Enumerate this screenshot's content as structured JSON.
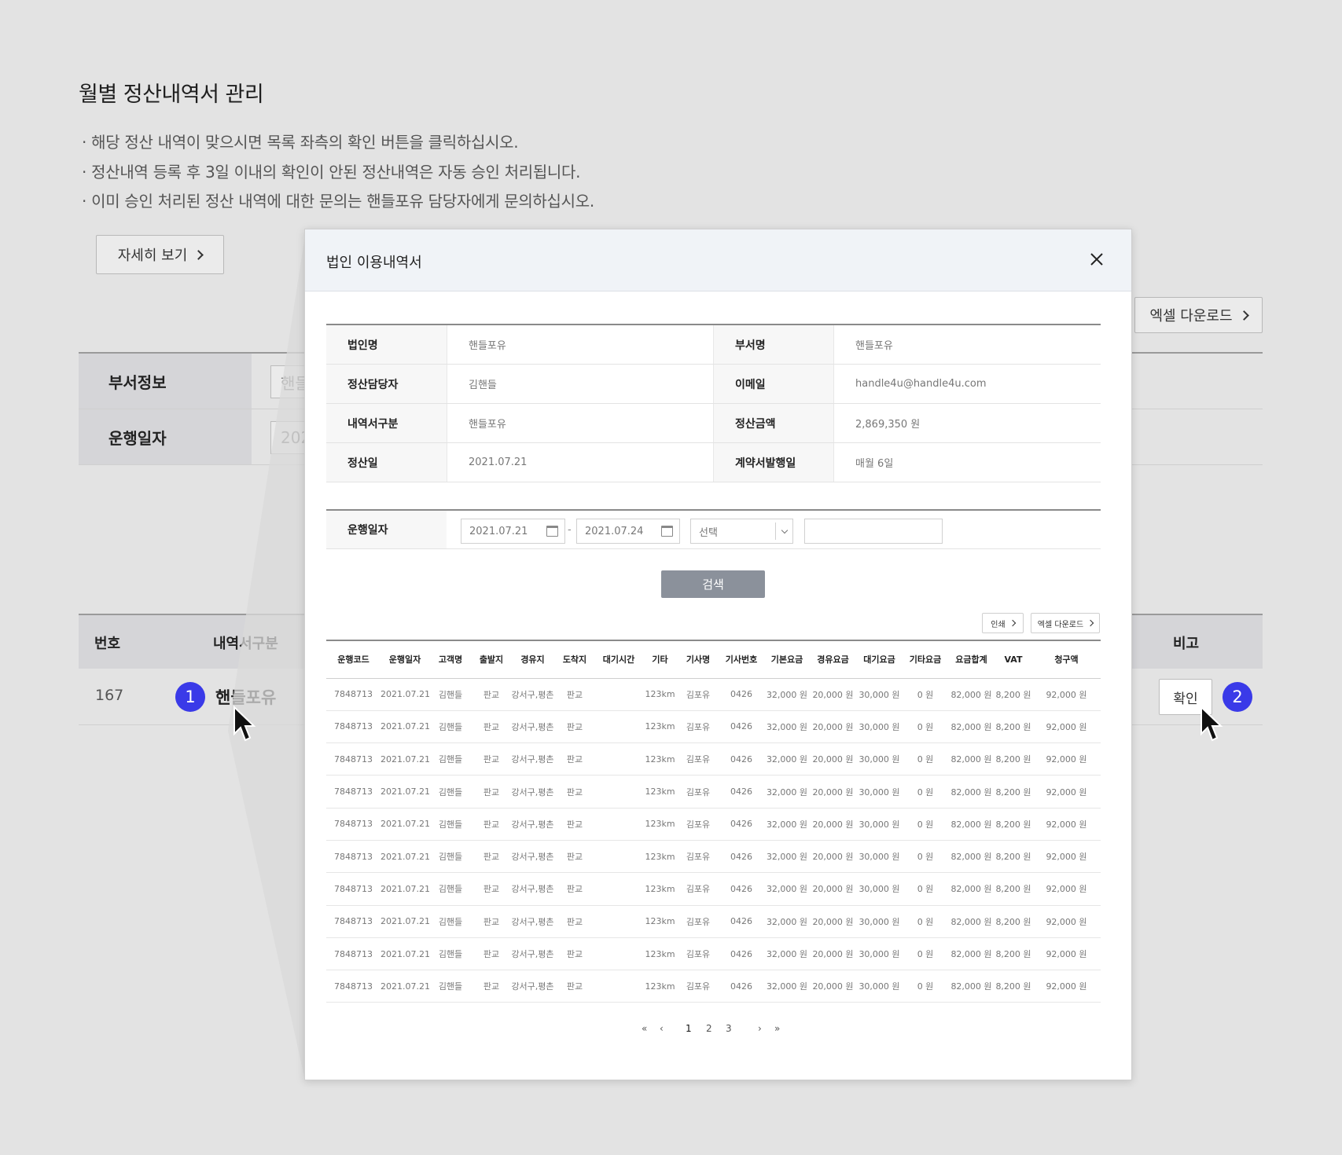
{
  "page": {
    "title": "월별 정산내역서 관리",
    "notices": [
      "· 해당 정산 내역이 맞으시면 목록 좌측의 확인 버튼을 클릭하십시오.",
      "· 정산내역 등록 후 3일 이내의 확인이 안된 정산내역은 자동 승인 처리됩니다.",
      "· 이미 승인 처리된 정산 내역에 대한 문의는 핸들포유 담당자에게 문의하십시오."
    ],
    "detail_button": "자세히 보기",
    "excel_button": "엑셀 다운로드",
    "filters": [
      {
        "label": "부서정보",
        "value": "핸들"
      },
      {
        "label": "운행일자",
        "value": "202"
      }
    ],
    "list_headers": {
      "num": "번호",
      "type": "내역서구분",
      "note": "비고"
    },
    "list_row": {
      "num": "167",
      "type": "핸들포유",
      "confirm": "확인"
    },
    "steps": [
      "1",
      "2"
    ]
  },
  "modal": {
    "title": "법인 이용내역서",
    "info": [
      [
        {
          "label": "법인명",
          "value": "핸들포유"
        },
        {
          "label": "부서명",
          "value": "핸들포유"
        }
      ],
      [
        {
          "label": "정산담당자",
          "value": "김핸들"
        },
        {
          "label": "이메일",
          "value": "handle4u@handle4u.com"
        }
      ],
      [
        {
          "label": "내역서구분",
          "value": "핸들포유"
        },
        {
          "label": "정산금액",
          "value": "2,869,350 원"
        }
      ],
      [
        {
          "label": "정산일",
          "value": "2021.07.21"
        },
        {
          "label": "계약서발행일",
          "value": "매월 6일"
        }
      ]
    ],
    "search": {
      "label": "운행일자",
      "date_from": "2021.07.21",
      "date_to": "2021.07.24",
      "separator": "-",
      "select": "선택",
      "button": "검색"
    },
    "print_button": "인쇄",
    "excel_button": "엑셀 다운로드",
    "columns": [
      "운행코드",
      "운행일자",
      "고객명",
      "출발지",
      "경유지",
      "도착지",
      "대기시간",
      "기타",
      "기사명",
      "기사번호",
      "기본요금",
      "경유요금",
      "대기요금",
      "기타요금",
      "요금합계",
      "VAT",
      "청구액"
    ],
    "rows": [
      [
        "7848713",
        "2021.07.21",
        "김핸들",
        "판교",
        "강서구,평촌",
        "판교",
        "",
        "123km",
        "김포유",
        "0426",
        "32,000 원",
        "20,000 원",
        "30,000 원",
        "0 원",
        "82,000 원",
        "8,200 원",
        "92,000 원"
      ],
      [
        "7848713",
        "2021.07.21",
        "김핸들",
        "판교",
        "강서구,평촌",
        "판교",
        "",
        "123km",
        "김포유",
        "0426",
        "32,000 원",
        "20,000 원",
        "30,000 원",
        "0 원",
        "82,000 원",
        "8,200 원",
        "92,000 원"
      ],
      [
        "7848713",
        "2021.07.21",
        "김핸들",
        "판교",
        "강서구,평촌",
        "판교",
        "",
        "123km",
        "김포유",
        "0426",
        "32,000 원",
        "20,000 원",
        "30,000 원",
        "0 원",
        "82,000 원",
        "8,200 원",
        "92,000 원"
      ],
      [
        "7848713",
        "2021.07.21",
        "김핸들",
        "판교",
        "강서구,평촌",
        "판교",
        "",
        "123km",
        "김포유",
        "0426",
        "32,000 원",
        "20,000 원",
        "30,000 원",
        "0 원",
        "82,000 원",
        "8,200 원",
        "92,000 원"
      ],
      [
        "7848713",
        "2021.07.21",
        "김핸들",
        "판교",
        "강서구,평촌",
        "판교",
        "",
        "123km",
        "김포유",
        "0426",
        "32,000 원",
        "20,000 원",
        "30,000 원",
        "0 원",
        "82,000 원",
        "8,200 원",
        "92,000 원"
      ],
      [
        "7848713",
        "2021.07.21",
        "김핸들",
        "판교",
        "강서구,평촌",
        "판교",
        "",
        "123km",
        "김포유",
        "0426",
        "32,000 원",
        "20,000 원",
        "30,000 원",
        "0 원",
        "82,000 원",
        "8,200 원",
        "92,000 원"
      ],
      [
        "7848713",
        "2021.07.21",
        "김핸들",
        "판교",
        "강서구,평촌",
        "판교",
        "",
        "123km",
        "김포유",
        "0426",
        "32,000 원",
        "20,000 원",
        "30,000 원",
        "0 원",
        "82,000 원",
        "8,200 원",
        "92,000 원"
      ],
      [
        "7848713",
        "2021.07.21",
        "김핸들",
        "판교",
        "강서구,평촌",
        "판교",
        "",
        "123km",
        "김포유",
        "0426",
        "32,000 원",
        "20,000 원",
        "30,000 원",
        "0 원",
        "82,000 원",
        "8,200 원",
        "92,000 원"
      ],
      [
        "7848713",
        "2021.07.21",
        "김핸들",
        "판교",
        "강서구,평촌",
        "판교",
        "",
        "123km",
        "김포유",
        "0426",
        "32,000 원",
        "20,000 원",
        "30,000 원",
        "0 원",
        "82,000 원",
        "8,200 원",
        "92,000 원"
      ],
      [
        "7848713",
        "2021.07.21",
        "김핸들",
        "판교",
        "강서구,평촌",
        "판교",
        "",
        "123km",
        "김포유",
        "0426",
        "32,000 원",
        "20,000 원",
        "30,000 원",
        "0 원",
        "82,000 원",
        "8,200 원",
        "92,000 원"
      ]
    ],
    "pagination": {
      "first": "«",
      "prev": "‹",
      "pages": [
        "1",
        "2",
        "3"
      ],
      "current": "1",
      "next": "›",
      "last": "»"
    }
  },
  "colors": {
    "accent": "#3a3ae8",
    "search_button": "#8b919b",
    "header_bg": "#f0f3f7"
  }
}
